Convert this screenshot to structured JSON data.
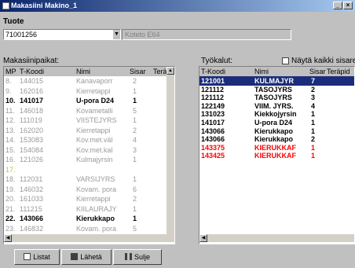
{
  "window": {
    "title": "Makasiini Makino_1"
  },
  "tuote": {
    "label": "Tuote",
    "value": "71001256",
    "secondary_value": "Koteto E64"
  },
  "left_panel": {
    "label": "Makasiinipaikat:",
    "columns": [
      "MP",
      "T-Koodi",
      "Nimi",
      "Sisar",
      "Terä"
    ],
    "rows": [
      {
        "mp": "8.",
        "code": "144015",
        "name": "Kanavaporr",
        "sisar": "2",
        "style": "gray"
      },
      {
        "mp": "9.",
        "code": "162016",
        "name": "Kierretappi",
        "sisar": "1",
        "style": "gray"
      },
      {
        "mp": "10.",
        "code": "141017",
        "name": "U-pora D24",
        "sisar": "1",
        "style": "black"
      },
      {
        "mp": "11.",
        "code": "146018",
        "name": "Kovametalli",
        "sisar": "5",
        "style": "gray"
      },
      {
        "mp": "12.",
        "code": "111019",
        "name": "VIISTEJYRS",
        "sisar": "1",
        "style": "gray"
      },
      {
        "mp": "13.",
        "code": "162020",
        "name": "Kierretappi",
        "sisar": "2",
        "style": "gray"
      },
      {
        "mp": "14.",
        "code": "153083",
        "name": "Kov.met.väl",
        "sisar": "4",
        "style": "gray"
      },
      {
        "mp": "15.",
        "code": "154084",
        "name": "Kov.met.kal",
        "sisar": "3",
        "style": "gray"
      },
      {
        "mp": "16.",
        "code": "121026",
        "name": "Kulmajyrsin",
        "sisar": "1",
        "style": "gray"
      },
      {
        "mp": "17.",
        "code": "",
        "name": "",
        "sisar": "",
        "style": "yellow"
      },
      {
        "mp": "18.",
        "code": "112031",
        "name": "VARSIJYRS",
        "sisar": "1",
        "style": "gray"
      },
      {
        "mp": "19.",
        "code": "146032",
        "name": "Kovam. pora",
        "sisar": "6",
        "style": "gray"
      },
      {
        "mp": "20.",
        "code": "161033",
        "name": "Kierretappi",
        "sisar": "2",
        "style": "gray"
      },
      {
        "mp": "21.",
        "code": "111215",
        "name": "KIILAURAJY",
        "sisar": "1",
        "style": "gray"
      },
      {
        "mp": "22.",
        "code": "143066",
        "name": "Kierukkapo",
        "sisar": "1",
        "style": "black"
      },
      {
        "mp": "23.",
        "code": "146832",
        "name": "Kovam. pora",
        "sisar": "5",
        "style": "gray"
      }
    ]
  },
  "right_panel": {
    "label": "Työkalut:",
    "checkbox_label": "Näytä kaikki sisaret",
    "columns": [
      "T-Koodi",
      "Nimi",
      "Sisar",
      "Teräpid"
    ],
    "rows": [
      {
        "code": "121001",
        "name": "KULMAJYR",
        "sisar": "7",
        "style": "selected"
      },
      {
        "code": "121112",
        "name": "TASOJYRS",
        "sisar": "2",
        "style": "black"
      },
      {
        "code": "121112",
        "name": "TASOJYRS",
        "sisar": "3",
        "style": "black"
      },
      {
        "code": "122149",
        "name": "VIIM. JYRS.",
        "sisar": "4",
        "style": "black"
      },
      {
        "code": "131023",
        "name": "Kiekkojyrsin",
        "sisar": "1",
        "style": "black"
      },
      {
        "code": "141017",
        "name": "U-pora D24",
        "sisar": "1",
        "style": "black"
      },
      {
        "code": "143066",
        "name": "Kierukkapo",
        "sisar": "1",
        "style": "black"
      },
      {
        "code": "143066",
        "name": "Kierukkapo",
        "sisar": "2",
        "style": "black"
      },
      {
        "code": "143375",
        "name": "KIERUKKAF",
        "sisar": "1",
        "style": "red"
      },
      {
        "code": "143425",
        "name": "KIERUKKAF",
        "sisar": "1",
        "style": "red"
      }
    ]
  },
  "buttons": {
    "listat": "Listat",
    "laheta": "Lähetä",
    "sulje": "Sulje"
  },
  "colors": {
    "selected_row": "#1b2d7a",
    "alert_row": "#ff0000",
    "inactive_row": "#9a9a9a"
  }
}
